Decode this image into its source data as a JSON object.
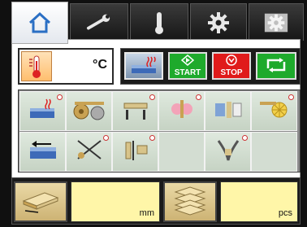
{
  "tabs": [
    {
      "id": "home",
      "icon": "home-icon",
      "active": true
    },
    {
      "id": "tools",
      "icon": "wrench-icon",
      "active": false
    },
    {
      "id": "temperature",
      "icon": "thermometer-icon",
      "active": false
    },
    {
      "id": "settings",
      "icon": "gear-icon",
      "active": false
    },
    {
      "id": "advanced-settings",
      "icon": "gear-badge-icon",
      "active": false
    }
  ],
  "temperature": {
    "unit": "°C",
    "icon": "thermometer-heat-icon"
  },
  "controls": {
    "heat_icon": "heater-icon",
    "start_label": "START",
    "stop_label": "STOP",
    "loop_icon": "loop-icon"
  },
  "functions": [
    {
      "icon": "heated-bench-icon",
      "indicator": true
    },
    {
      "icon": "roll-feed-icon",
      "indicator": false
    },
    {
      "icon": "clamp-icon",
      "indicator": true
    },
    {
      "icon": "glue-application-icon",
      "indicator": true
    },
    {
      "icon": "press-icon",
      "indicator": false
    },
    {
      "icon": "brush-roller-icon",
      "indicator": true
    },
    {
      "icon": "board-feed-icon",
      "indicator": false
    },
    {
      "icon": "cutter-icon",
      "indicator": true
    },
    {
      "icon": "end-trim-icon",
      "indicator": true
    },
    {
      "icon": "empty",
      "indicator": false
    },
    {
      "icon": "corner-round-icon",
      "indicator": true
    },
    {
      "icon": "empty",
      "indicator": false
    }
  ],
  "bottom": {
    "length_icon": "board-length-icon",
    "length_unit": "mm",
    "count_icon": "board-stack-icon",
    "count_unit": "pcs"
  },
  "colors": {
    "start": "#1eaa2c",
    "stop": "#e01b1b",
    "field": "#fff6a8"
  }
}
